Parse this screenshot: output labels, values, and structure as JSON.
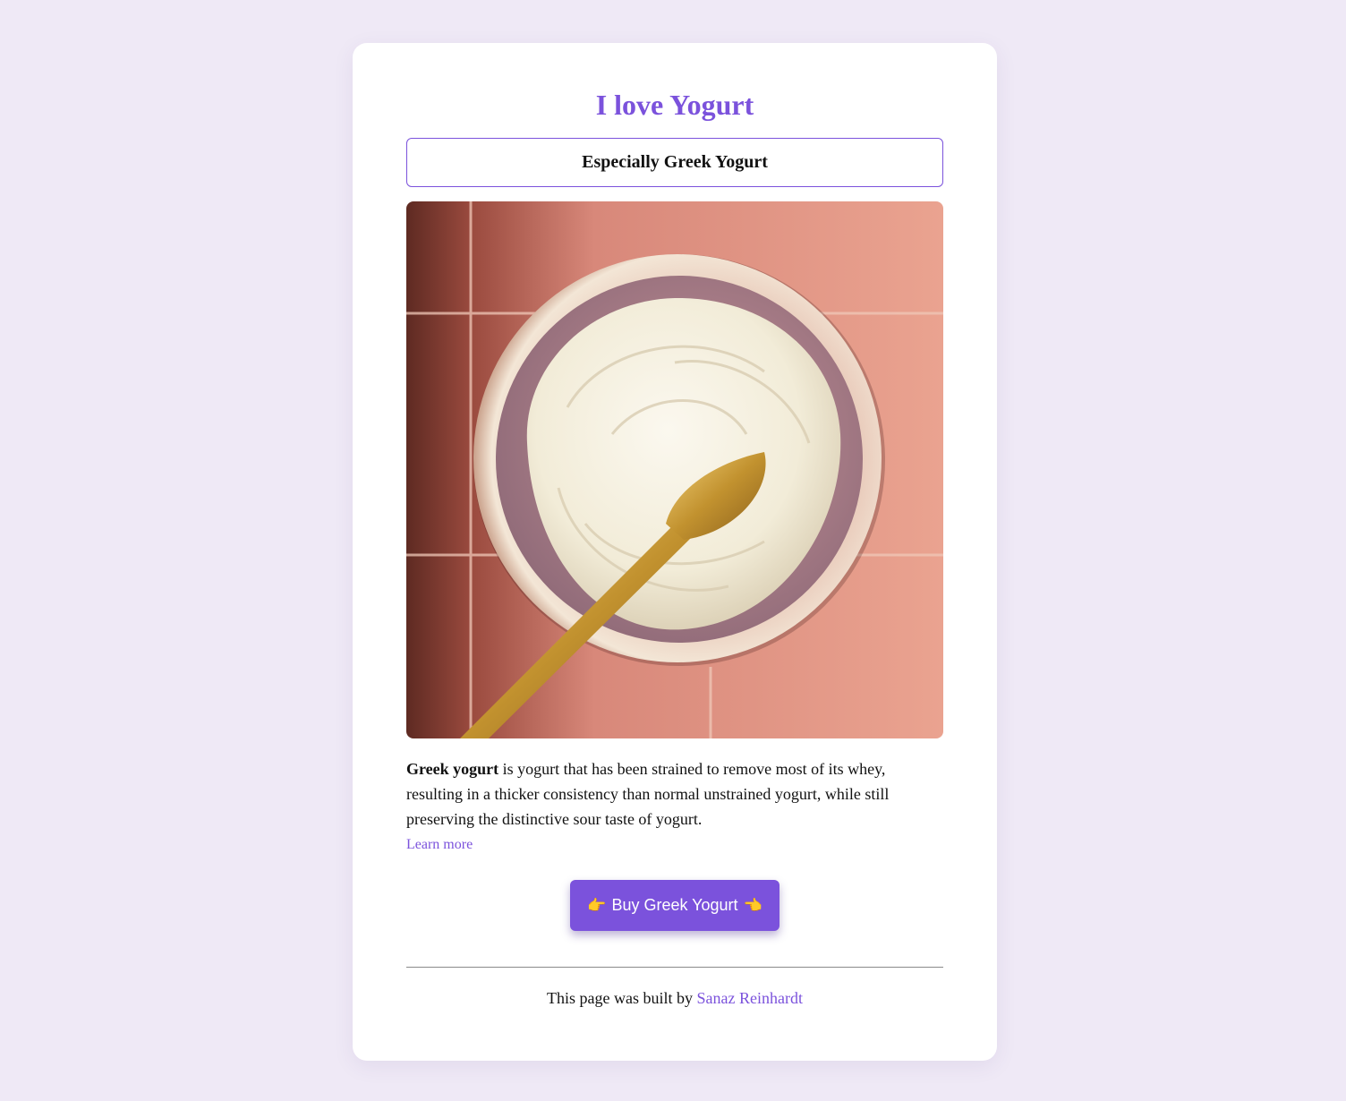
{
  "page": {
    "title": "I love Yogurt",
    "subtitle": "Especially Greek Yogurt"
  },
  "image": {
    "alt": "Greek yogurt in a bowl with a golden spoon"
  },
  "description": {
    "term": "Greek yogurt",
    "text": " is yogurt that has been strained to remove most of its whey, resulting in a thicker consistency than normal unstrained yogurt, while still preserving the distinctive sour taste of yogurt.",
    "learn_more": "Learn more"
  },
  "cta": {
    "left_icon": "👉",
    "label": "Buy Greek Yogurt",
    "right_icon": "👈"
  },
  "footer": {
    "prefix": "This page was built by ",
    "author": "Sanaz Reinhardt"
  },
  "colors": {
    "accent": "#7b52dc",
    "background": "#efe9f6",
    "card": "#ffffff"
  }
}
